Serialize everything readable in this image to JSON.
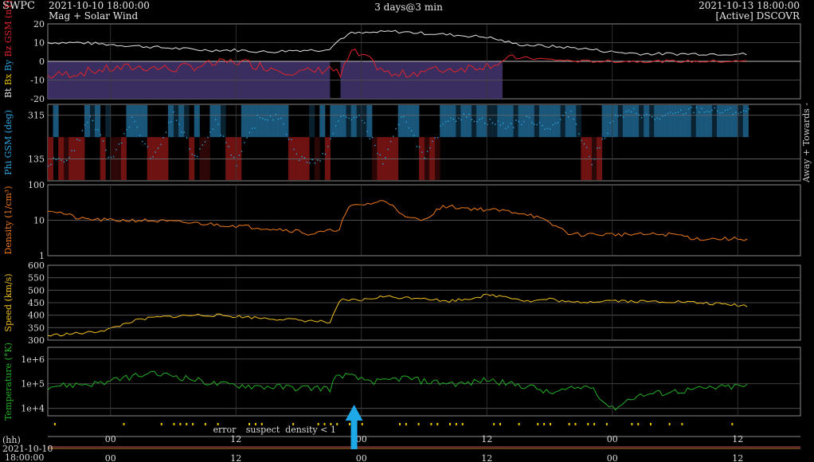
{
  "header": {
    "source": "SWPC",
    "start_time": "2021-10-10 18:00:00",
    "product": "Mag + Solar Wind",
    "span": "3 days@3 min",
    "end_time": "2021-10-13 18:00:00",
    "spacecraft": "[Active] DSCOVR"
  },
  "colors": {
    "bz": "#e0242a",
    "bt": "#e6e6e6",
    "bx": "#e8c400",
    "by": "#2aa6e0",
    "phi": "#2aa6e0",
    "density": "#f07a1c",
    "speed": "#f0c020",
    "temperature": "#22b022",
    "away": "#1d5f86",
    "towards": "#7a1414",
    "neg_bz": "#443570",
    "arrow": "#1fa8e8"
  },
  "footer": {
    "hh_label": "(hh)",
    "date_label": "2021-10-10",
    "time_label": "18:00:00",
    "quality_legend": [
      {
        "text": "error",
        "color": "#e0242a"
      },
      {
        "text": "suspect",
        "color": "#e8c400"
      },
      {
        "text": "density < 1",
        "color": "#f07a1c"
      }
    ]
  },
  "chart_data": [
    {
      "type": "line",
      "title": "Mag",
      "ylabel_parts": [
        "Bt",
        "Bx",
        "By",
        "Bz GSM (nT)"
      ],
      "ylim": [
        -20,
        20
      ],
      "yticks": [
        "20",
        "10",
        "0",
        "-10",
        "-20"
      ],
      "xticks": [
        "00",
        "12",
        "00",
        "12",
        "00",
        "12"
      ],
      "series": [
        {
          "name": "Bt",
          "x": [
            0,
            3,
            6,
            9,
            12,
            15,
            18,
            21,
            24,
            26,
            27,
            28,
            29,
            30,
            33,
            36,
            39,
            42,
            45,
            48,
            51,
            54,
            57,
            60,
            63,
            66,
            69,
            72
          ],
          "values": [
            10,
            10,
            9,
            8,
            7,
            6,
            6,
            5,
            6,
            6,
            7,
            12,
            15,
            15,
            16,
            15,
            14,
            13,
            9,
            8,
            7,
            5,
            4,
            4,
            4,
            4,
            3,
            3
          ]
        },
        {
          "name": "Bz",
          "x": [
            0,
            3,
            6,
            9,
            12,
            15,
            18,
            21,
            24,
            26,
            27,
            28,
            29,
            30,
            33,
            36,
            39,
            42,
            45,
            48,
            51,
            54,
            57,
            60,
            63,
            66,
            69,
            72
          ],
          "values": [
            -8,
            -6,
            -4,
            -3,
            -4,
            -2,
            0,
            -3,
            -6,
            -5,
            -3,
            -8,
            5,
            3,
            -8,
            -5,
            -4,
            -2,
            2,
            1,
            0,
            0,
            0,
            0,
            0,
            0,
            0,
            0
          ]
        }
      ]
    },
    {
      "type": "scatter",
      "ylabel": "Phi GSM (deg)",
      "side_label": "Away + Towards -",
      "ylim": [
        45,
        360
      ],
      "yticks": [
        "315",
        "135"
      ],
      "xticks": [
        "00",
        "12",
        "00",
        "12",
        "00",
        "12"
      ],
      "series": [
        {
          "name": "Phi",
          "x": [
            0,
            2,
            4,
            6,
            8,
            10,
            12,
            14,
            16,
            18,
            20,
            22,
            24,
            26,
            28,
            30,
            32,
            34,
            36,
            38,
            40,
            42,
            44,
            46,
            48,
            50,
            52,
            54,
            56,
            58,
            60,
            62,
            64,
            66,
            68,
            70,
            72
          ],
          "values": [
            120,
            140,
            310,
            130,
            300,
            130,
            320,
            140,
            290,
            120,
            300,
            310,
            140,
            120,
            310,
            300,
            120,
            320,
            130,
            300,
            310,
            290,
            270,
            300,
            260,
            330,
            120,
            300,
            330,
            300,
            320,
            340,
            330,
            330,
            330,
            340,
            340
          ]
        }
      ]
    },
    {
      "type": "line",
      "ylabel": "Density (1/cm³)",
      "yscale": "log",
      "ylim": [
        1,
        100
      ],
      "yticks": [
        "100",
        "10",
        "1"
      ],
      "xticks": [
        "00",
        "12",
        "00",
        "12",
        "00",
        "12"
      ],
      "series": [
        {
          "name": "Density",
          "x": [
            0,
            3,
            6,
            9,
            12,
            15,
            18,
            21,
            24,
            25,
            27,
            28,
            29,
            31,
            32,
            33,
            34,
            36,
            38,
            40,
            42,
            44,
            46,
            48,
            50,
            52,
            54,
            56,
            58,
            60,
            62,
            64,
            66,
            68,
            70,
            72
          ],
          "values": [
            20,
            11,
            10,
            10,
            9,
            8,
            7,
            6,
            5,
            4,
            5,
            6,
            25,
            30,
            35,
            28,
            12,
            10,
            25,
            22,
            20,
            18,
            15,
            8,
            4,
            4,
            4,
            4,
            4,
            4,
            3,
            3,
            3,
            3,
            3,
            3
          ]
        }
      ]
    },
    {
      "type": "line",
      "ylabel": "Speed (km/s)",
      "ylim": [
        300,
        600
      ],
      "yticks": [
        "600",
        "550",
        "500",
        "450",
        "400",
        "350",
        "300"
      ],
      "xticks": [
        "00",
        "12",
        "00",
        "12",
        "00",
        "12"
      ],
      "series": [
        {
          "name": "Speed",
          "x": [
            0,
            2,
            4,
            6,
            8,
            10,
            12,
            14,
            16,
            18,
            20,
            22,
            24,
            26,
            27,
            28,
            30,
            32,
            34,
            36,
            38,
            40,
            42,
            44,
            46,
            48,
            50,
            52,
            54,
            56,
            58,
            60,
            62,
            64,
            66,
            68,
            70,
            72
          ],
          "values": [
            318,
            325,
            330,
            345,
            375,
            390,
            395,
            400,
            400,
            395,
            390,
            385,
            380,
            375,
            370,
            460,
            460,
            475,
            470,
            470,
            455,
            465,
            480,
            475,
            455,
            465,
            450,
            455,
            460,
            455,
            455,
            455,
            450,
            445,
            440,
            435,
            430,
            425
          ]
        }
      ]
    },
    {
      "type": "line",
      "ylabel": "Temperature (°K)",
      "yscale": "log",
      "ylim": [
        5000,
        3000000
      ],
      "yticks": [
        "1e+6",
        "1e+5",
        "1e+4"
      ],
      "xticks": [
        "00",
        "12",
        "00",
        "12",
        "00",
        "12"
      ],
      "series": [
        {
          "name": "Temperature",
          "x": [
            0,
            2,
            4,
            6,
            8,
            10,
            12,
            14,
            16,
            18,
            20,
            22,
            24,
            26,
            27,
            28,
            30,
            32,
            34,
            36,
            38,
            40,
            42,
            44,
            46,
            48,
            50,
            52,
            53,
            54,
            55,
            56,
            58,
            60,
            62,
            64,
            66,
            68,
            70,
            72
          ],
          "values": [
            80000,
            90000,
            100000,
            120000,
            200000,
            250000,
            220000,
            150000,
            100000,
            90000,
            80000,
            75000,
            70000,
            70000,
            65000,
            250000,
            150000,
            120000,
            180000,
            130000,
            110000,
            100000,
            150000,
            100000,
            80000,
            40000,
            60000,
            80000,
            20000,
            10000,
            15000,
            30000,
            40000,
            50000,
            60000,
            70000,
            80000,
            80000,
            90000,
            100000
          ]
        }
      ]
    }
  ]
}
